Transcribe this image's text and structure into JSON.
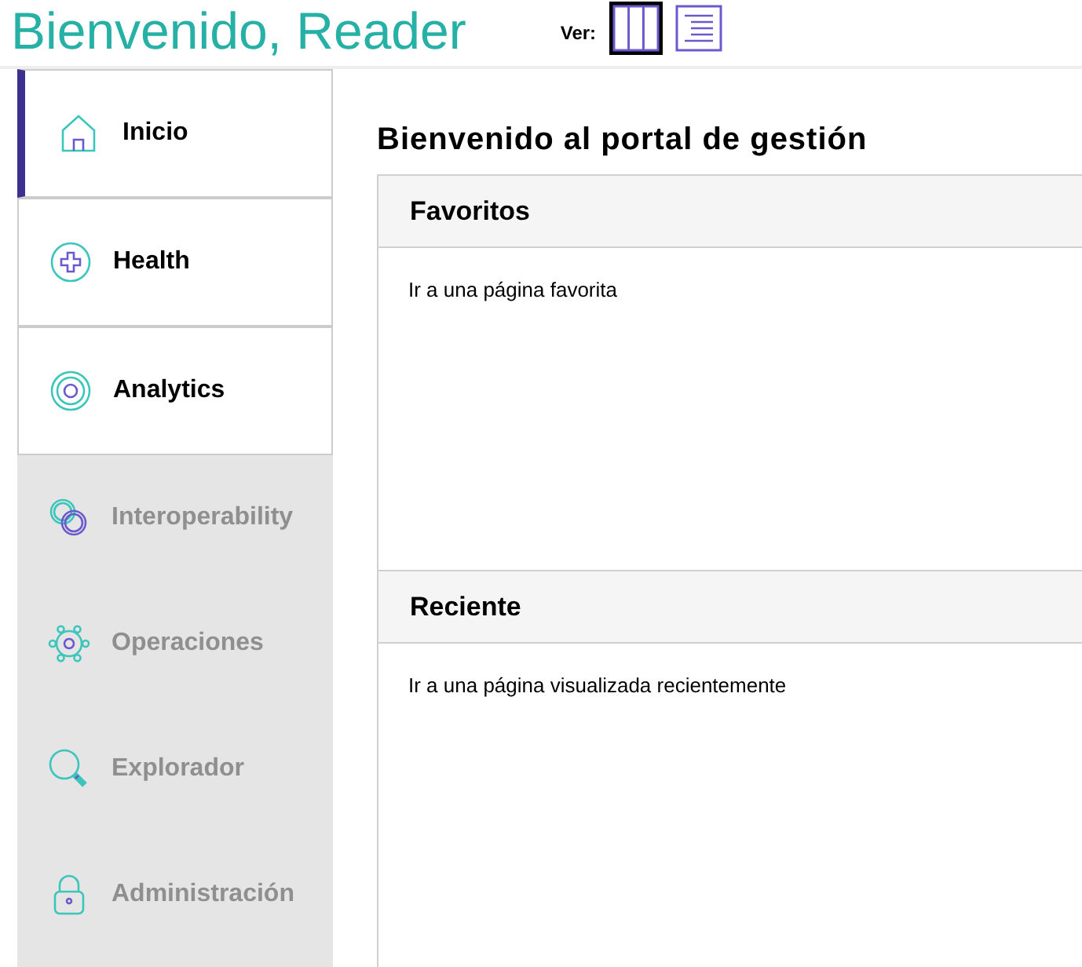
{
  "header": {
    "title": "Bienvenido, Reader",
    "view_label": "Ver:",
    "view_options": [
      {
        "kind": "columns",
        "selected": true
      },
      {
        "kind": "list",
        "selected": false
      }
    ]
  },
  "sidebar": {
    "items": [
      {
        "label": "Inicio",
        "kind": "home",
        "selected": true,
        "disabled": false
      },
      {
        "label": "Health",
        "kind": "health",
        "selected": false,
        "disabled": false
      },
      {
        "label": "Analytics",
        "kind": "analytics",
        "selected": false,
        "disabled": false
      },
      {
        "label": "Interoperability",
        "kind": "interop",
        "selected": false,
        "disabled": true
      },
      {
        "label": "Operaciones",
        "kind": "operations",
        "selected": false,
        "disabled": true
      },
      {
        "label": "Explorador",
        "kind": "explorer",
        "selected": false,
        "disabled": true
      },
      {
        "label": "Administración",
        "kind": "admin",
        "selected": false,
        "disabled": true
      }
    ]
  },
  "main": {
    "title": "Bienvenido al portal de gestión",
    "panels": [
      {
        "title": "Favoritos",
        "text": "Ir a una página favorita"
      },
      {
        "title": "Reciente",
        "text": "Ir a una página visualizada recientemente"
      }
    ]
  }
}
